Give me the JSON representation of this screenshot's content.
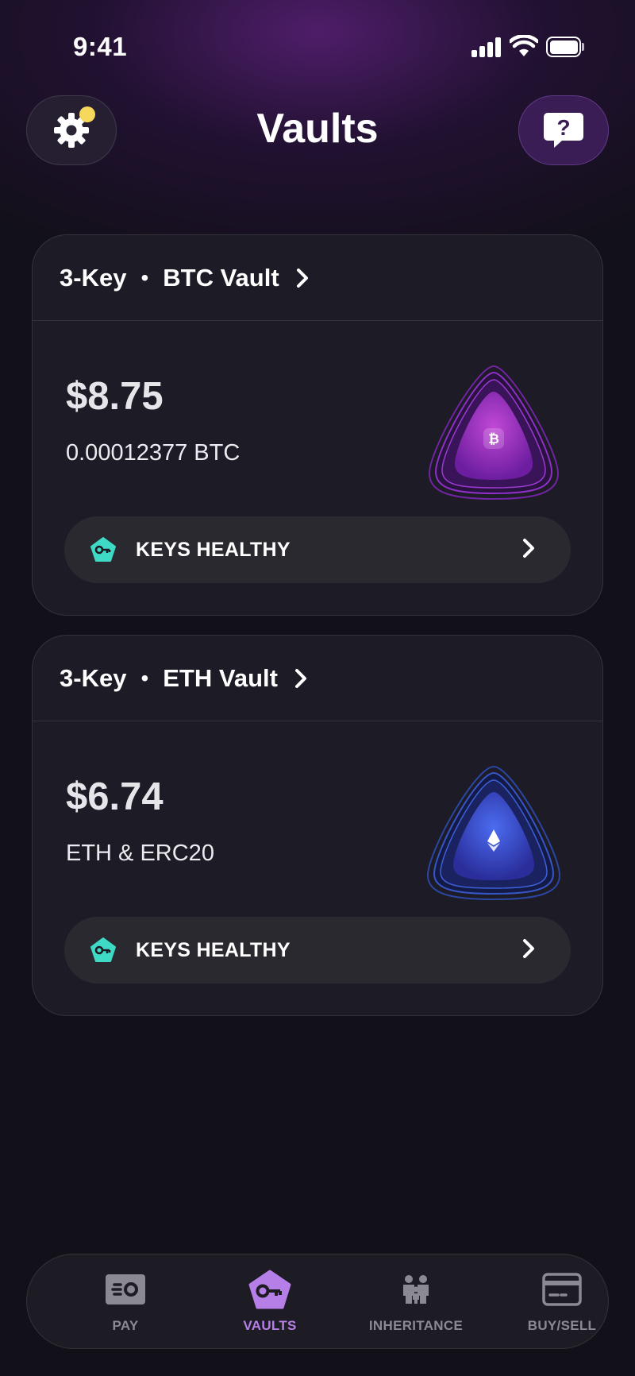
{
  "status_bar": {
    "time": "9:41"
  },
  "header": {
    "title": "Vaults"
  },
  "vaults": [
    {
      "key_type": "3-Key",
      "separator": "•",
      "name": "BTC Vault",
      "amount": "$8.75",
      "balance": "0.00012377 BTC",
      "status": "KEYS HEALTHY",
      "coin_icon": "bitcoin-icon",
      "accent": "#a53ad1"
    },
    {
      "key_type": "3-Key",
      "separator": "•",
      "name": "ETH Vault",
      "amount": "$6.74",
      "balance": "ETH & ERC20",
      "status": "KEYS HEALTHY",
      "coin_icon": "ethereum-icon",
      "accent": "#3f5be0"
    }
  ],
  "tabs": [
    {
      "label": "PAY",
      "icon": "pay-icon",
      "active": false
    },
    {
      "label": "VAULTS",
      "icon": "vault-key-icon",
      "active": true
    },
    {
      "label": "INHERITANCE",
      "icon": "family-icon",
      "active": false
    },
    {
      "label": "BUY/SELL",
      "icon": "card-icon",
      "active": false
    }
  ],
  "colors": {
    "background": "#121019",
    "accent_purple": "#b67fe8",
    "key_teal": "#3fdac6",
    "notification": "#f5d85c"
  }
}
